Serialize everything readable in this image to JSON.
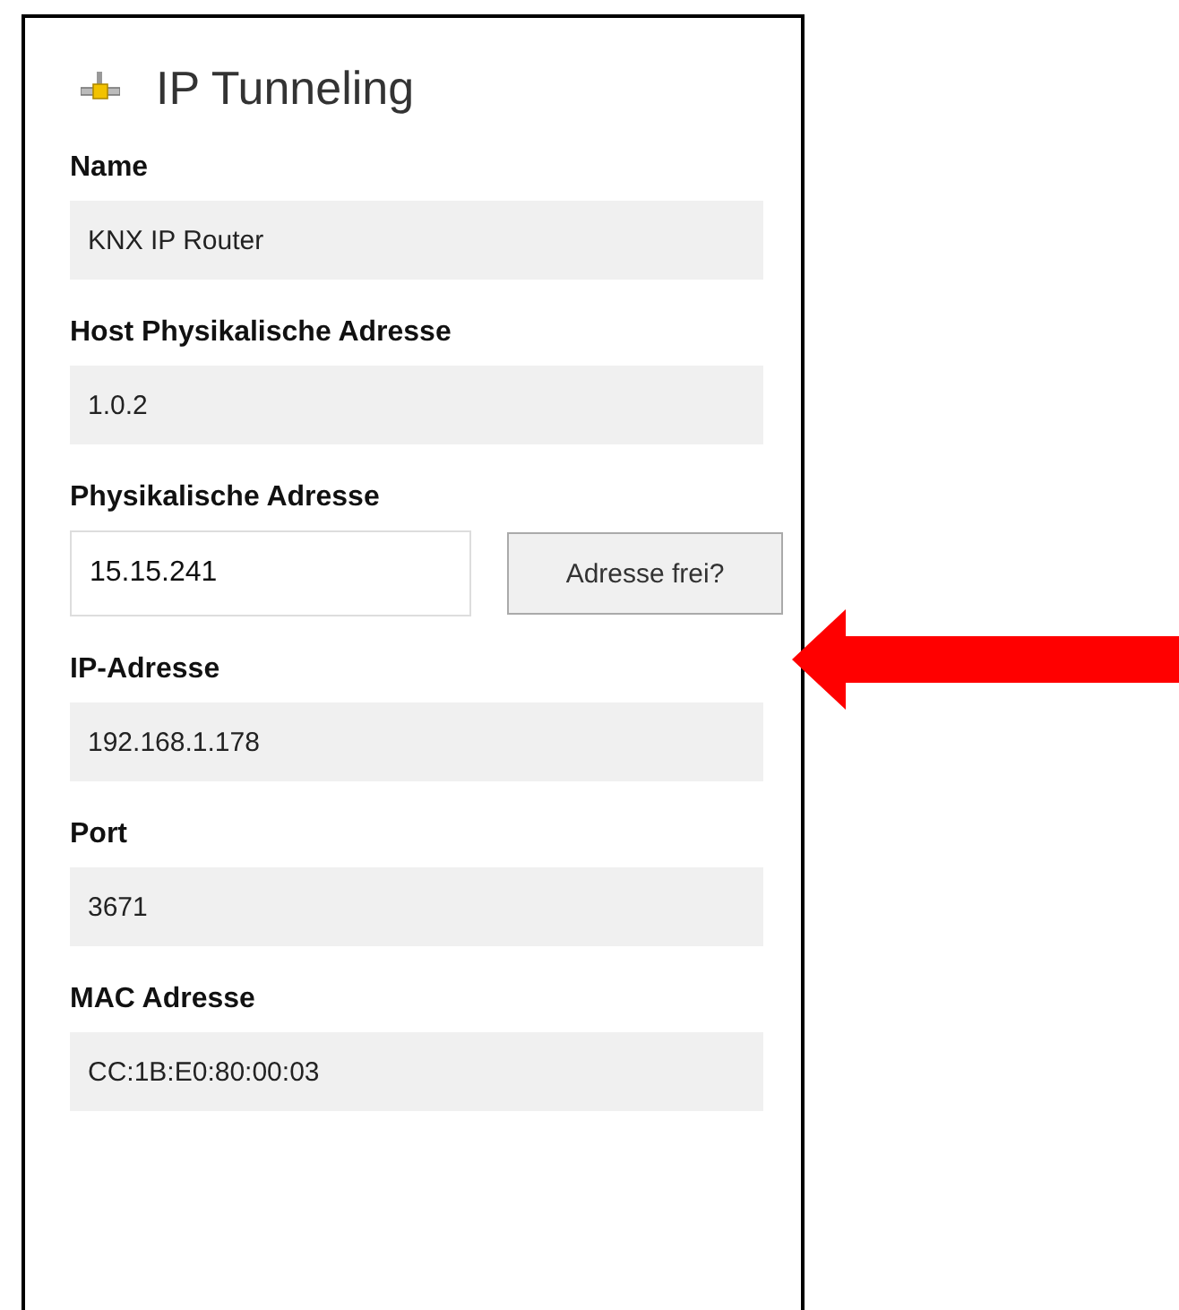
{
  "panel": {
    "title": "IP Tunneling"
  },
  "fields": [
    {
      "label": "Name",
      "kind": "readonly",
      "value": "KNX IP Router"
    },
    {
      "label": "Host Physikalische Adresse",
      "kind": "readonly",
      "value": "1.0.2"
    },
    {
      "label": "Physikalische Adresse",
      "kind": "editable",
      "value": "15.15.241",
      "button": "Adresse frei?"
    },
    {
      "label": "IP-Adresse",
      "kind": "readonly",
      "value": "192.168.1.178"
    },
    {
      "label": "Port",
      "kind": "readonly",
      "value": "3671"
    },
    {
      "label": "MAC Adresse",
      "kind": "readonly",
      "value": "CC:1B:E0:80:00:03"
    }
  ]
}
